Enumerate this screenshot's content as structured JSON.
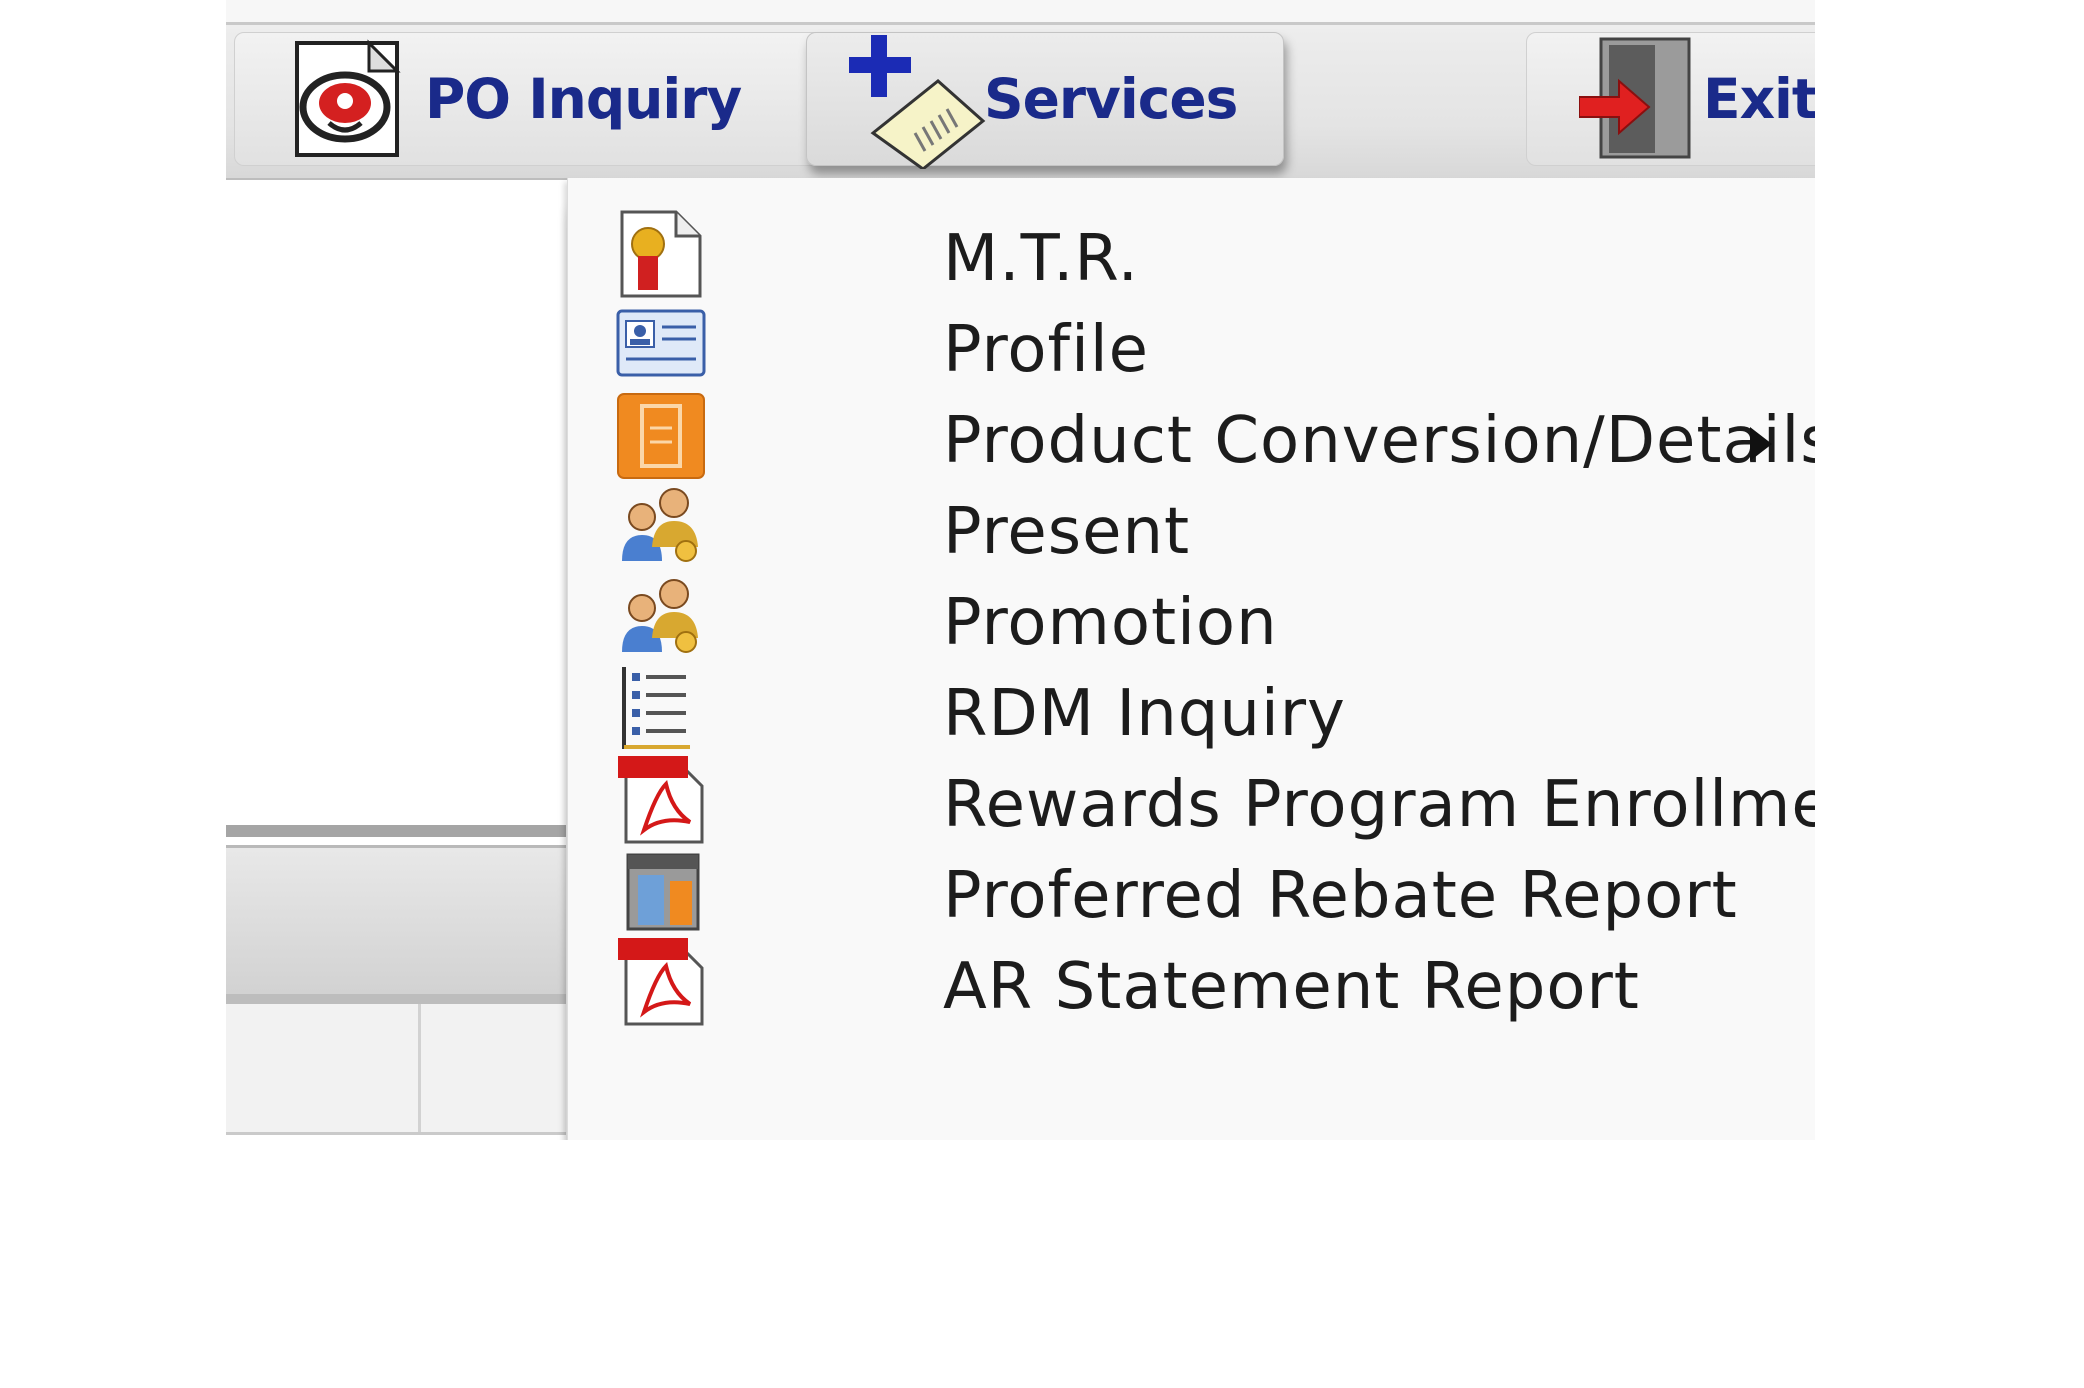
{
  "toolbar": {
    "po_inquiry_label": "PO Inquiry",
    "services_label": "Services",
    "exit_label": "Exit"
  },
  "services_menu": {
    "items": [
      {
        "label": "M.T.R.",
        "icon": "certificate-icon"
      },
      {
        "label": "Profile",
        "icon": "id-card-icon"
      },
      {
        "label": "Product Conversion/Details",
        "icon": "orange-panel-icon",
        "has_submenu": true
      },
      {
        "label": "Present",
        "icon": "users-key-icon"
      },
      {
        "label": "Promotion",
        "icon": "users-key-icon"
      },
      {
        "label": "RDM Inquiry",
        "icon": "list-icon"
      },
      {
        "label": "Rewards Program Enrollment Form",
        "icon": "pdf-icon"
      },
      {
        "label": "Proferred Rebate Report",
        "icon": "report-icon"
      },
      {
        "label": "AR Statement Report",
        "icon": "pdf-icon"
      }
    ]
  },
  "colors": {
    "toolbar_text": "#1a2a8a",
    "menu_text": "#1c1c1c",
    "menu_bg": "#f9f9f9"
  }
}
